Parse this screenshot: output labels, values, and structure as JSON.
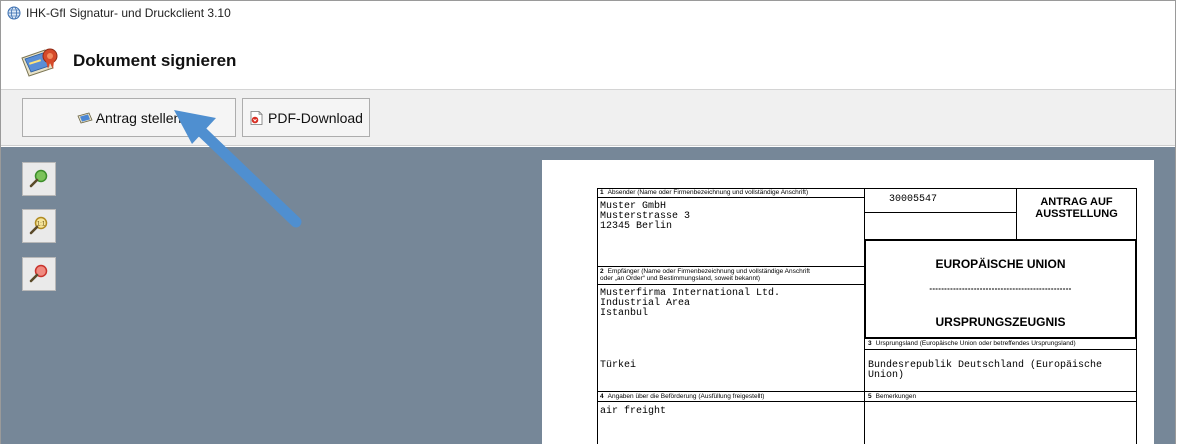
{
  "window": {
    "title": "IHK-GfI Signatur- und Druckclient 3.10",
    "heading": "Dokument signieren"
  },
  "toolbar": {
    "antrag_label": "Antrag stellen",
    "pdf_label": "PDF-Download"
  },
  "zoom_buttons": [
    {
      "icon": "zoom-in-icon",
      "color": "#3c8d2a"
    },
    {
      "icon": "zoom-fit-icon",
      "color": "#d8b23a"
    },
    {
      "icon": "zoom-out-icon",
      "color": "#c8332c"
    }
  ],
  "form": {
    "f1_label_num": "1",
    "f1_label": "Absender (Name oder Firmenbezeichnung und vollständige Anschrift)",
    "f1_value": "Muster GmbH\nMusterstrasse 3\n12345 Berlin",
    "number": "30005547",
    "antrag_title": "ANTRAG AUF\nAUSSTELLUNG",
    "f2_label_num": "2",
    "f2_label": "Empfänger (Name oder Firmenbezeichnung und vollständige Anschrift\noder „an Order“ und Bestimmungsland, soweit bekannt)",
    "f2_value": "Musterfirma International Ltd.\nIndustrial Area\nIstanbul",
    "eu_title": "EUROPÄISCHE UNION",
    "dashes": "------------------------------------------------",
    "ursprung_title": "URSPRUNGSZEUGNIS",
    "f3_label_num": "3",
    "f3_label": "Ursprungsland (Europäische Union oder betreffendes Ursprungsland)",
    "country_dest": "Türkei",
    "f3_value": "Bundesrepublik Deutschland (Europäische\nUnion)",
    "f4_label_num": "4",
    "f4_label": "Angaben über die Beförderung (Ausfüllung freigestellt)",
    "f4_value": "air freight",
    "f5_label_num": "5",
    "f5_label": "Bemerkungen"
  },
  "colors": {
    "viewer_bg": "#768798",
    "arrow": "#4f8fd0"
  }
}
